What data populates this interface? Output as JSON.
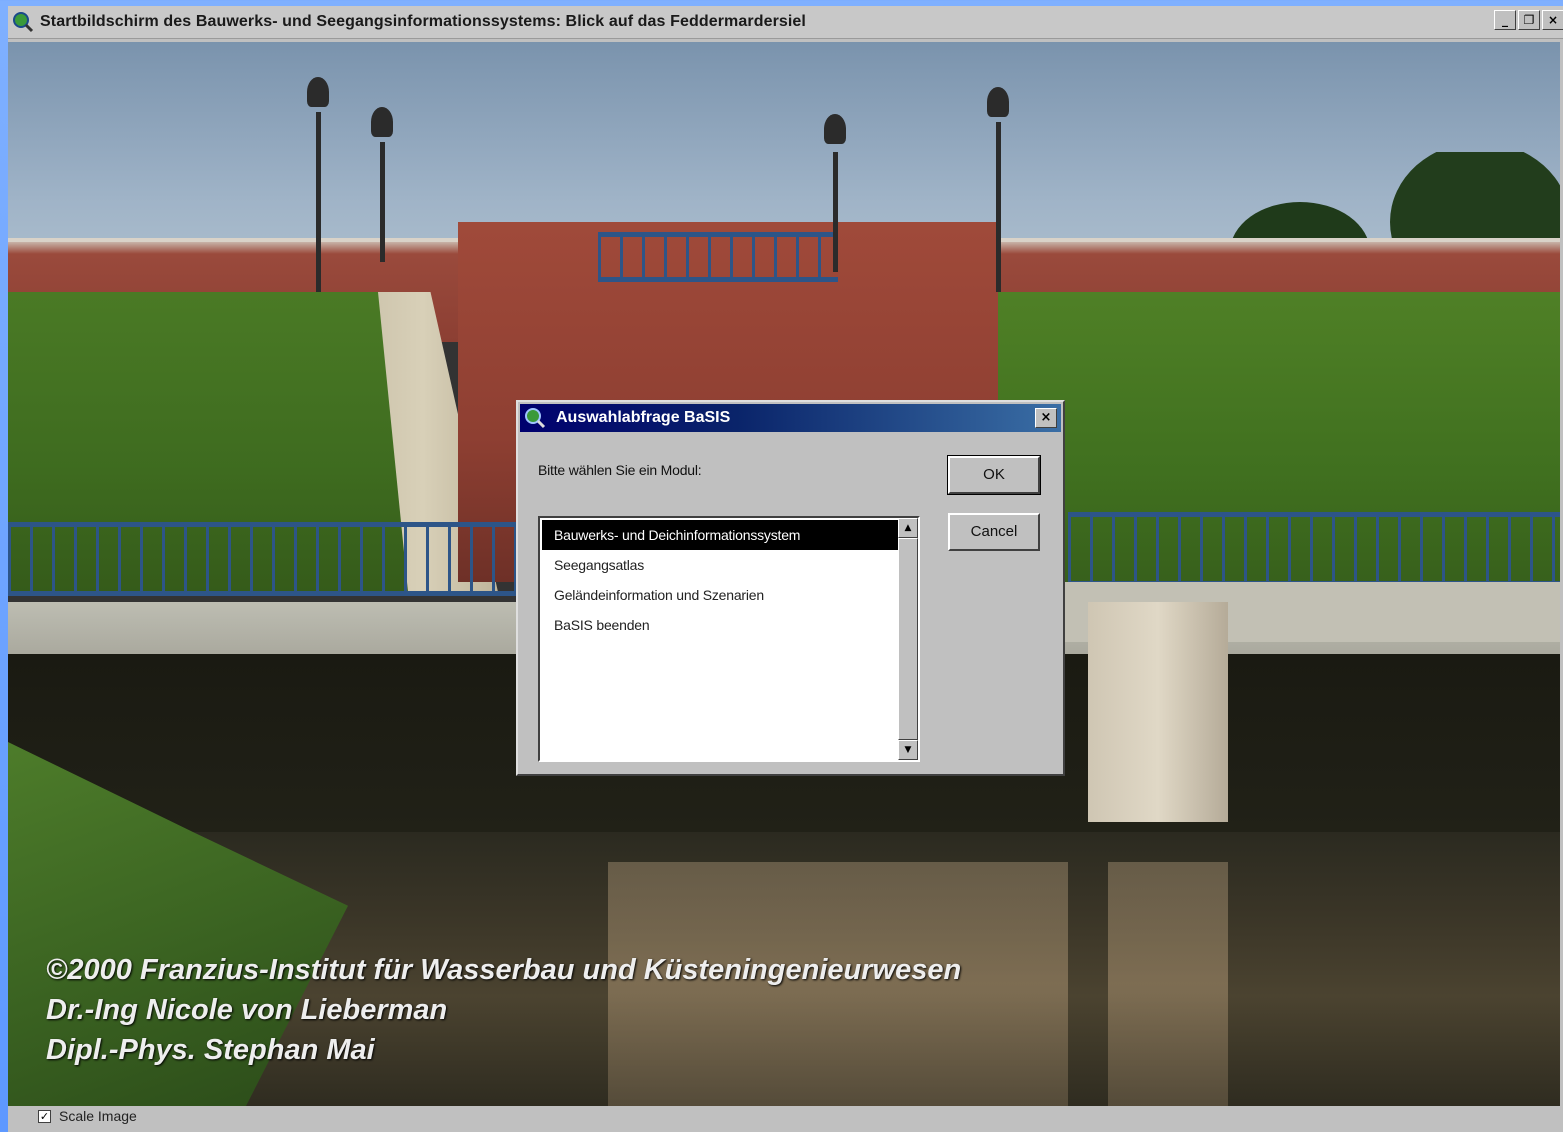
{
  "window": {
    "title": "Startbildschirm des Bauwerks- und Seegangsinformationssystems: Blick auf das Feddermardersiel",
    "controls": {
      "minimize": "_",
      "restore": "̅",
      "close": "×"
    }
  },
  "credits": {
    "line1": "©2000 Franzius-Institut für Wasserbau und Küsteningenieurwesen",
    "line2": "Dr.-Ing Nicole von Lieberman",
    "line3": "Dipl.-Phys. Stephan Mai"
  },
  "statusbar": {
    "scale_image_label": "Scale Image",
    "scale_image_checked": true
  },
  "dialog": {
    "title": "Auswahlabfrage BaSIS",
    "close_label": "×",
    "prompt": "Bitte wählen Sie ein Modul:",
    "ok_label": "OK",
    "cancel_label": "Cancel",
    "items": [
      {
        "label": "Bauwerks- und Deichinformationssystem",
        "selected": true
      },
      {
        "label": "Seegangsatlas",
        "selected": false
      },
      {
        "label": "Geländeinformation und Szenarien",
        "selected": false
      },
      {
        "label": "BaSIS beenden",
        "selected": false
      }
    ]
  },
  "colors": {
    "dialog_title_start": "#00006e",
    "dialog_title_end": "#3a6ea5",
    "window_bg": "#c0c0c0"
  }
}
